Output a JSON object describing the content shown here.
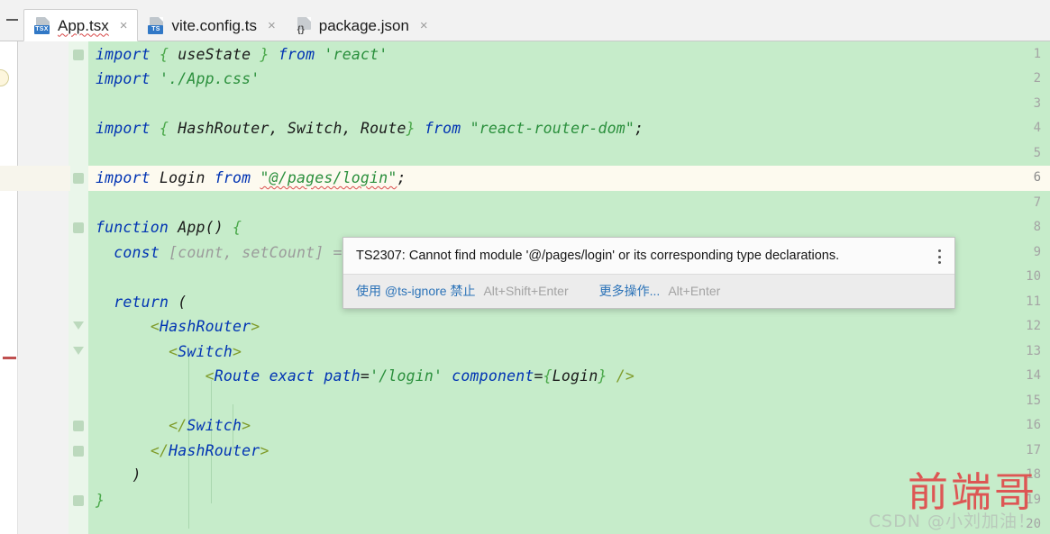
{
  "tabs": {
    "collapse_label": "—",
    "items": [
      {
        "label": "App.tsx",
        "icon": "tsx-file-icon",
        "badge": "TSX",
        "close": "×",
        "active": true
      },
      {
        "label": "vite.config.ts",
        "icon": "ts-file-icon",
        "badge": "TS",
        "close": "×",
        "active": false
      },
      {
        "label": "package.json",
        "icon": "json-file-icon",
        "badge": "{}",
        "close": "×",
        "active": false
      }
    ]
  },
  "editor": {
    "file": "App.tsx",
    "current_line": 6,
    "colors": {
      "background": "#c6ecca",
      "current_line": "#fdfaef",
      "gutter": "#f2f2f2",
      "keyword": "#0033b3",
      "string": "#2a8f3c",
      "error_squiggle": "#d94a4a",
      "error_marker": "#c05050"
    },
    "lines": [
      {
        "n": "1",
        "text": "import { useState } from 'react'"
      },
      {
        "n": "2",
        "text": "import './App.css'"
      },
      {
        "n": "3",
        "text": ""
      },
      {
        "n": "4",
        "text": "import { HashRouter, Switch, Route} from \"react-router-dom\";"
      },
      {
        "n": "5",
        "text": ""
      },
      {
        "n": "6",
        "text": "import Login from \"@/pages/login\";"
      },
      {
        "n": "7",
        "text": ""
      },
      {
        "n": "8",
        "text": "function App() {"
      },
      {
        "n": "9",
        "text": "  const [count, setCount] = useState(0)"
      },
      {
        "n": "10",
        "text": ""
      },
      {
        "n": "11",
        "text": "  return ("
      },
      {
        "n": "12",
        "text": "      <HashRouter>"
      },
      {
        "n": "13",
        "text": "        <Switch>"
      },
      {
        "n": "14",
        "text": "            <Route exact path='/login' component={Login} />"
      },
      {
        "n": "15",
        "text": ""
      },
      {
        "n": "16",
        "text": "        </Switch>"
      },
      {
        "n": "17",
        "text": "      </HashRouter>"
      },
      {
        "n": "18",
        "text": "    )"
      },
      {
        "n": "19",
        "text": "}"
      },
      {
        "n": "20",
        "text": ""
      }
    ]
  },
  "tooltip": {
    "message": "TS2307: Cannot find module '@/pages/login' or its corresponding type declarations.",
    "kebab_icon": "more-options-icon",
    "actions": [
      {
        "label": "使用 @ts-ignore 禁止",
        "shortcut": "Alt+Shift+Enter"
      },
      {
        "label": "更多操作...",
        "shortcut": "Alt+Enter"
      }
    ]
  },
  "watermark": {
    "main": "前端哥",
    "sub": "CSDN @小刘加油！"
  }
}
